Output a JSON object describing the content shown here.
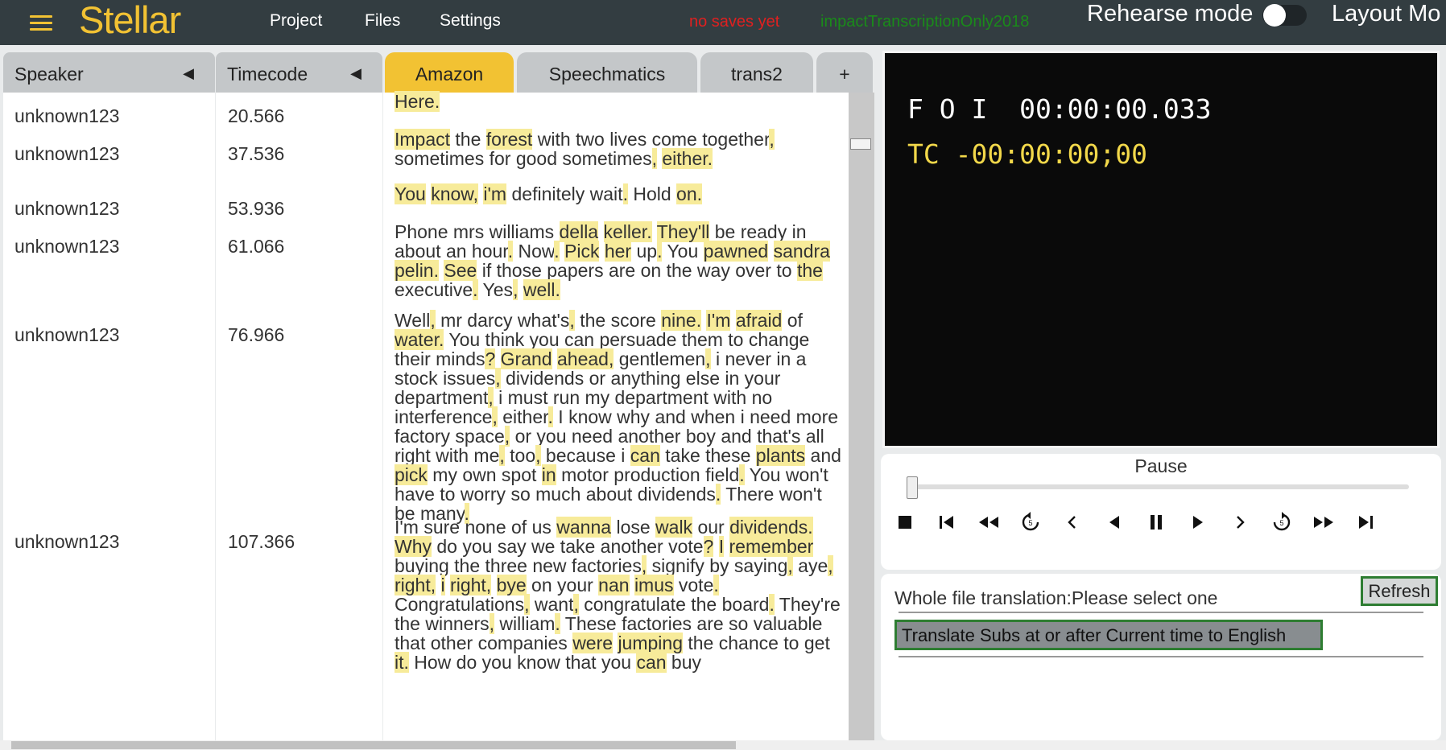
{
  "app": {
    "logo": "Stellar"
  },
  "nav": [
    "Project",
    "Files",
    "Settings"
  ],
  "status": {
    "saves": "no saves yet",
    "project": "impactTranscriptionOnly2018"
  },
  "rehearse": {
    "label": "Rehearse mode",
    "on": false
  },
  "layout_label": "Layout Mo",
  "columns": {
    "speaker": "Speaker",
    "timecode": "Timecode",
    "arrow": "◀"
  },
  "tabs": [
    "Amazon",
    "Speechmatics",
    "trans2",
    "+"
  ],
  "rows": [
    {
      "speaker": "unknown123",
      "time": "20.566"
    },
    {
      "speaker": "unknown123",
      "time": "37.536"
    },
    {
      "speaker": "unknown123",
      "time": "53.936"
    },
    {
      "speaker": "unknown123",
      "time": "61.066"
    },
    {
      "speaker": "unknown123",
      "time": "76.966"
    },
    {
      "speaker": "unknown123",
      "time": "107.366"
    }
  ],
  "transcript": [
    [
      [
        "Here.",
        true
      ]
    ],
    [
      [
        "Impact",
        true
      ],
      [
        " the ",
        false
      ],
      [
        "forest",
        true
      ],
      [
        " with two lives come together",
        false
      ],
      [
        ",",
        true
      ],
      [
        " sometimes for good sometimes",
        false
      ],
      [
        ",",
        true
      ],
      [
        " ",
        false
      ],
      [
        "either.",
        true
      ]
    ],
    [
      [
        "You",
        true
      ],
      [
        " ",
        false
      ],
      [
        "know,",
        true
      ],
      [
        " ",
        false
      ],
      [
        "i'm",
        true
      ],
      [
        " definitely wait",
        false
      ],
      [
        ".",
        true
      ],
      [
        " Hold ",
        false
      ],
      [
        "on.",
        true
      ]
    ],
    [
      [
        "Phone mrs williams ",
        false
      ],
      [
        "della",
        true
      ],
      [
        " ",
        false
      ],
      [
        "keller.",
        true
      ],
      [
        " ",
        false
      ],
      [
        "They'll",
        true
      ],
      [
        " be ready in about an hour",
        false
      ],
      [
        ".",
        true
      ],
      [
        " Now",
        false
      ],
      [
        ".",
        true
      ],
      [
        " ",
        false
      ],
      [
        "Pick",
        true
      ],
      [
        " ",
        false
      ],
      [
        "her",
        true
      ],
      [
        " up",
        false
      ],
      [
        ".",
        true
      ],
      [
        " You ",
        false
      ],
      [
        "pawned",
        true
      ],
      [
        " ",
        false
      ],
      [
        "sandra",
        true
      ],
      [
        " ",
        false
      ],
      [
        "pelin.",
        true
      ],
      [
        " ",
        false
      ],
      [
        "See",
        true
      ],
      [
        " if those papers are on the way over to ",
        false
      ],
      [
        "the",
        true
      ],
      [
        " executive",
        false
      ],
      [
        ".",
        true
      ],
      [
        " Yes",
        false
      ],
      [
        ",",
        true
      ],
      [
        " ",
        false
      ],
      [
        "well.",
        true
      ]
    ],
    [
      [
        "Well",
        false
      ],
      [
        ",",
        true
      ],
      [
        " mr darcy what's",
        false
      ],
      [
        ",",
        true
      ],
      [
        " the score ",
        false
      ],
      [
        "nine.",
        true
      ],
      [
        " ",
        false
      ],
      [
        "I'm",
        true
      ],
      [
        " ",
        false
      ],
      [
        "afraid",
        true
      ],
      [
        " of ",
        false
      ],
      [
        "water.",
        true
      ],
      [
        " You think you can persuade them to change their minds",
        false
      ],
      [
        "?",
        true
      ],
      [
        " ",
        false
      ],
      [
        "Grand",
        true
      ],
      [
        " ",
        false
      ],
      [
        "ahead,",
        true
      ],
      [
        " gentlemen",
        false
      ],
      [
        ",",
        true
      ],
      [
        " i never in a stock issues",
        false
      ],
      [
        ",",
        true
      ],
      [
        " dividends or anything else in your department",
        false
      ],
      [
        ",",
        true
      ],
      [
        " i must run my department with no interference",
        false
      ],
      [
        ",",
        true
      ],
      [
        " either",
        false
      ],
      [
        ".",
        true
      ],
      [
        " I know why and when i need more factory space",
        false
      ],
      [
        ",",
        true
      ],
      [
        " or you need another boy and that's all right with me",
        false
      ],
      [
        ",",
        true
      ],
      [
        " too",
        false
      ],
      [
        ",",
        true
      ],
      [
        " because i ",
        false
      ],
      [
        "can",
        true
      ],
      [
        " take these ",
        false
      ],
      [
        "plants",
        true
      ],
      [
        " and ",
        false
      ],
      [
        "pick",
        true
      ],
      [
        " my own spot ",
        false
      ],
      [
        "in",
        true
      ],
      [
        " motor production field",
        false
      ],
      [
        ".",
        true
      ],
      [
        " You won't have to worry so much about dividends",
        false
      ],
      [
        ".",
        true
      ],
      [
        " There won't be many",
        false
      ],
      [
        ".",
        true
      ]
    ],
    [
      [
        "I'm sure none of us ",
        false
      ],
      [
        "wanna",
        true
      ],
      [
        " lose ",
        false
      ],
      [
        "walk",
        true
      ],
      [
        " our ",
        false
      ],
      [
        "dividends.",
        true
      ],
      [
        " ",
        false
      ],
      [
        "Why",
        true
      ],
      [
        " do you say we take another vote",
        false
      ],
      [
        "?",
        true
      ],
      [
        " ",
        false
      ],
      [
        "I",
        true
      ],
      [
        " ",
        false
      ],
      [
        "remember",
        true
      ],
      [
        " buying the three new factories",
        false
      ],
      [
        ",",
        true
      ],
      [
        " signify by saying",
        false
      ],
      [
        ",",
        true
      ],
      [
        " aye",
        false
      ],
      [
        ",",
        true
      ],
      [
        " ",
        false
      ],
      [
        "right,",
        true
      ],
      [
        " ",
        false
      ],
      [
        "i",
        true
      ],
      [
        " ",
        false
      ],
      [
        "right,",
        true
      ],
      [
        " ",
        false
      ],
      [
        "bye",
        true
      ],
      [
        " on your ",
        false
      ],
      [
        "nan",
        true
      ],
      [
        " ",
        false
      ],
      [
        "imus",
        true
      ],
      [
        " vote",
        false
      ],
      [
        ".",
        true
      ],
      [
        " Congratulations",
        false
      ],
      [
        ",",
        true
      ],
      [
        " want",
        false
      ],
      [
        ",",
        true
      ],
      [
        " congratulate the board",
        false
      ],
      [
        ".",
        true
      ],
      [
        " They're the winners",
        false
      ],
      [
        ",",
        true
      ],
      [
        " william",
        false
      ],
      [
        ".",
        true
      ],
      [
        " These factories are so valuable that other companies ",
        false
      ],
      [
        "were",
        true
      ],
      [
        " ",
        false
      ],
      [
        "jumping",
        true
      ],
      [
        " the chance to get ",
        false
      ],
      [
        "it.",
        true
      ],
      [
        " How do you know that you ",
        false
      ],
      [
        "can",
        true
      ],
      [
        " buy",
        false
      ]
    ]
  ],
  "video": {
    "foi": "F O I  00:00:00.033",
    "tc": "TC -00:00:00;00"
  },
  "controls": {
    "pause_label": "Pause",
    "position_fraction": 0.0
  },
  "translation": {
    "label": "Whole file translation:Please select one",
    "refresh": "Refresh",
    "subs_button": "Translate Subs at or after Current time to English"
  },
  "accent": "#f2c233"
}
